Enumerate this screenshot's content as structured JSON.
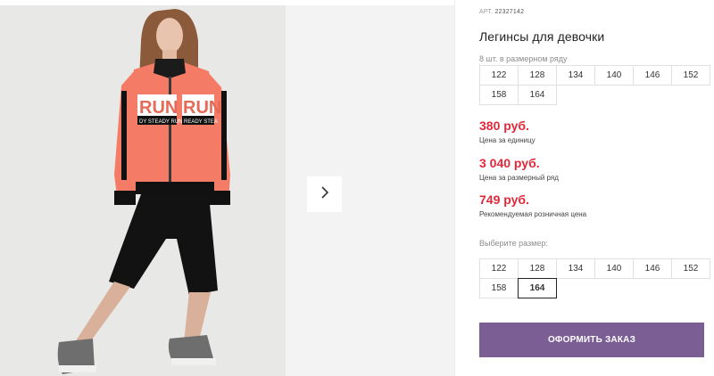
{
  "product": {
    "sku_label": "АРТ.",
    "sku_value": "22327142",
    "title": "Легинсы для девочки",
    "image_alt": "girl-model-photo"
  },
  "size_row": {
    "label": "8 шт. в размерном ряду",
    "sizes": [
      "122",
      "128",
      "134",
      "140",
      "146",
      "152",
      "158",
      "164"
    ]
  },
  "prices": [
    {
      "value": "380 руб.",
      "caption": "Цена за единицу"
    },
    {
      "value": "3 040 руб.",
      "caption": "Цена за размерный ряд"
    },
    {
      "value": "749 руб.",
      "caption": "Рекомендуемая розничная цена"
    }
  ],
  "size_select": {
    "label": "Выберите размер:",
    "sizes": [
      "122",
      "128",
      "134",
      "140",
      "146",
      "152",
      "158",
      "164"
    ],
    "selected": "164"
  },
  "order_button": {
    "label": "ОФОРМИТЬ ЗАКАЗ"
  },
  "colors": {
    "price": "#e3283a",
    "accent": "#7b5e94"
  },
  "icons": {
    "next": "chevron-right-icon"
  }
}
